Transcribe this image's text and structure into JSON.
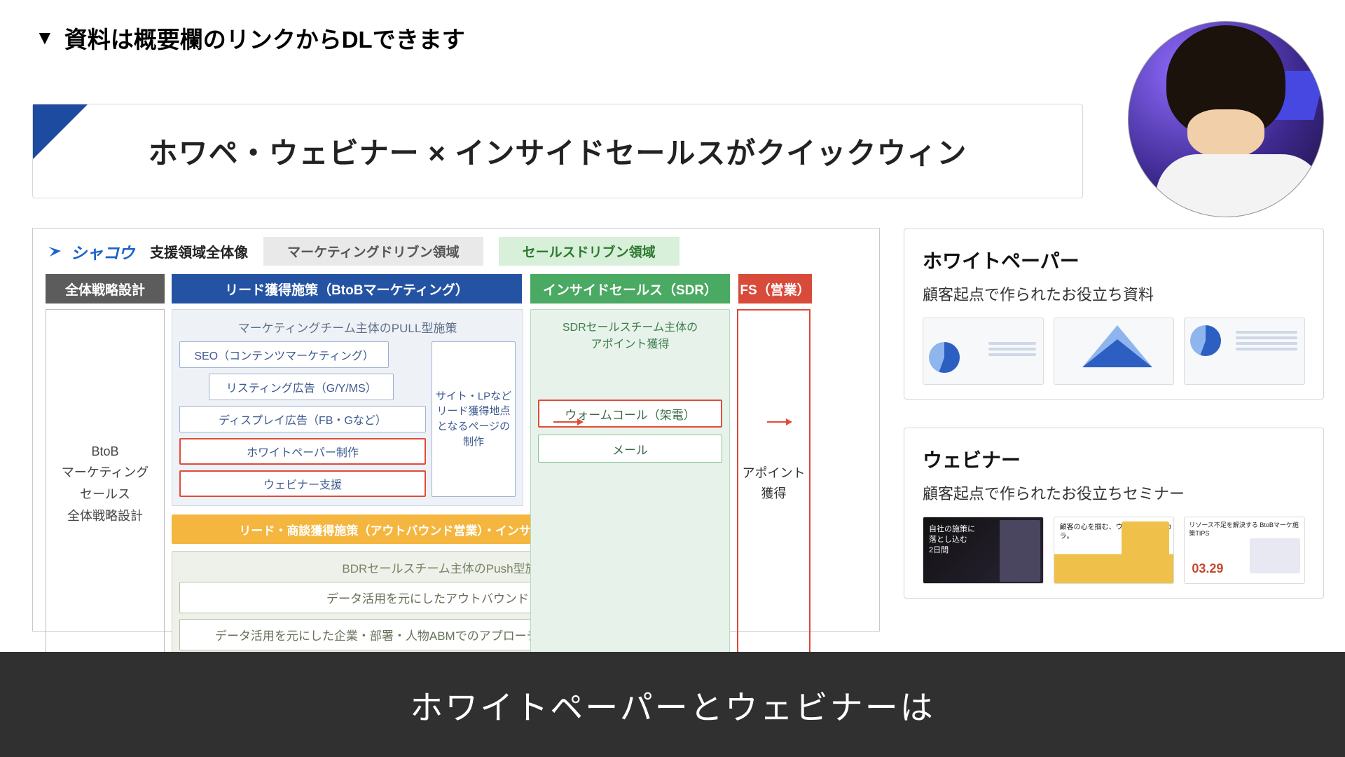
{
  "top_note": "資料は概要欄のリンクからDLできます",
  "slide": {
    "title": "ホワペ・ウェビナー × インサイドセールスがクイックウィン"
  },
  "diagram": {
    "brand": "シャコウ",
    "header_labels": {
      "scope": "支援領域全体像",
      "mkt": "マーケティングドリブン領域",
      "sales": "セールスドリブン領域"
    },
    "row2": {
      "side": "全体戦略設計",
      "lead": "リード獲得施策（BtoBマーケティング）",
      "sdr": "インサイドセールス（SDR）",
      "fs": "FS（営業）"
    },
    "side_col": "BtoB\nマーケティング\nセールス\n全体戦略設計",
    "pull": {
      "title": "マーケティングチーム主体のPULL型施策",
      "left": [
        "SEO（コンテンツマーケティング）",
        "リスティング広告（G/Y/MS）",
        "ディスプレイ広告（FB・Gなど）",
        "ホワイトペーパー制作",
        "ウェビナー支援"
      ],
      "right": "サイト・LPなどリード獲得地点となるページの制作"
    },
    "yellowbar": "リード・商談獲得施策（アウトバウンド営業）・インサイドセールス（BDR）",
    "bdr": {
      "title": "BDRセールスチーム主体のPush型施策",
      "cells": [
        "データ活用を元にしたアウトバウンドコール",
        "データ活用を元にした企業・部署・人物ABMでのアプローチ（手紙DM・展示会など）"
      ]
    },
    "sdr": {
      "title": "SDRセールスチーム主体の\nアポイント獲得",
      "cells": [
        "ウォームコール（架電）",
        "メール"
      ]
    },
    "fs_col": "アポイント\n獲得"
  },
  "cards": {
    "wp": {
      "title": "ホワイトペーパー",
      "subtitle": "顧客起点で作られたお役立ち資料"
    },
    "wb": {
      "title": "ウェビナー",
      "subtitle": "顧客起点で作られたお役立ちセミナー",
      "thumb1_lines": [
        "自社の施策に",
        "落とし込む",
        "2日間"
      ],
      "thumb2_line": "顧客の心を掴む、ウェビナーのチカラ。",
      "thumb3_line": "リソース不足を解決する BtoBマーケ施策TIPS",
      "date": "03.29"
    }
  },
  "caption": "ホワイトペーパーとウェビナーは"
}
